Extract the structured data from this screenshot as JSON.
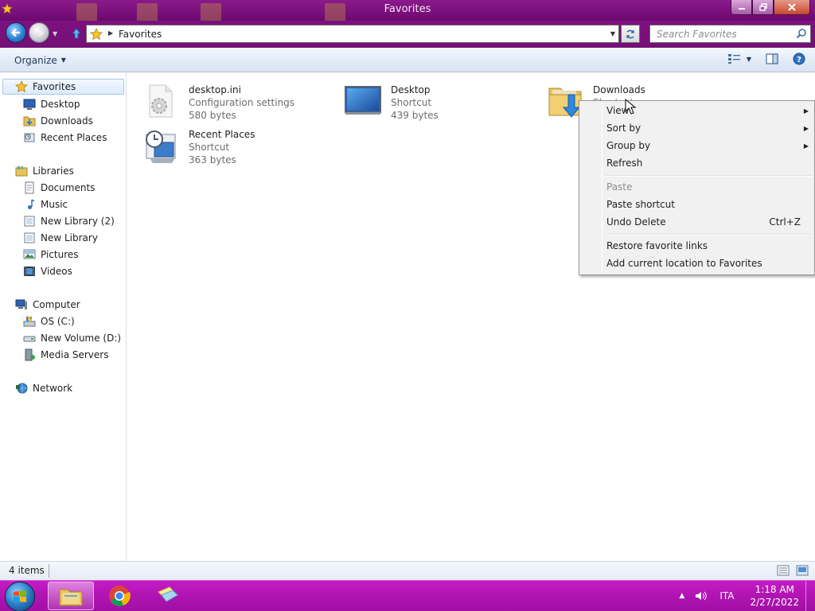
{
  "window": {
    "title": "Favorites"
  },
  "address": {
    "location": "Favorites",
    "search_placeholder": "Search Favorites"
  },
  "toolbar": {
    "organize_label": "Organize"
  },
  "sidebar": {
    "favorites": {
      "label": "Favorites",
      "items": [
        "Desktop",
        "Downloads",
        "Recent Places"
      ]
    },
    "libraries": {
      "label": "Libraries",
      "items": [
        "Documents",
        "Music",
        "New Library (2)",
        "New Library",
        "Pictures",
        "Videos"
      ]
    },
    "computer": {
      "label": "Computer",
      "items": [
        "OS (C:)",
        "New Volume (D:)",
        "Media Servers"
      ]
    },
    "network": {
      "label": "Network"
    }
  },
  "files": [
    {
      "name": "desktop.ini",
      "type": "Configuration settings",
      "size": "580 bytes",
      "icon": "settings-file-icon"
    },
    {
      "name": "Desktop",
      "type": "Shortcut",
      "size": "439 bytes",
      "icon": "desktop-icon"
    },
    {
      "name": "Downloads",
      "type": "Shortcut",
      "size": "",
      "icon": "downloads-folder-icon"
    },
    {
      "name": "Recent Places",
      "type": "Shortcut",
      "size": "363 bytes",
      "icon": "recent-places-icon"
    }
  ],
  "context_menu": {
    "items": [
      {
        "label": "View",
        "submenu": true
      },
      {
        "label": "Sort by",
        "submenu": true
      },
      {
        "label": "Group by",
        "submenu": true
      },
      {
        "label": "Refresh"
      },
      {
        "label": "Paste",
        "disabled": true
      },
      {
        "label": "Paste shortcut"
      },
      {
        "label": "Undo Delete",
        "shortcut": "Ctrl+Z"
      },
      {
        "label": "Restore favorite links"
      },
      {
        "label": "Add current location to Favorites"
      }
    ]
  },
  "status": {
    "item_count": "4 items"
  },
  "taskbar": {
    "language": "ITA",
    "time": "1:18 AM",
    "date": "2/27/2022"
  },
  "colors": {
    "titlebar": "#7a0f7c",
    "taskbar": "#b014b2",
    "selection": "#dcebfc"
  }
}
